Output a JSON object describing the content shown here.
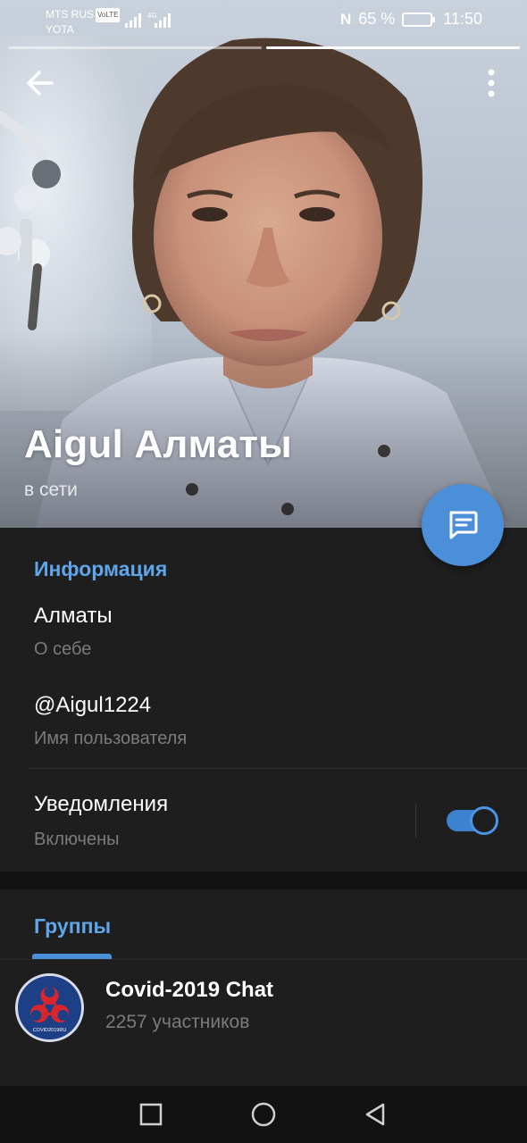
{
  "status_bar": {
    "carrier_line1": "MTS RUS",
    "volte": "VoLTE",
    "carrier_line2": "YOTA",
    "network": "4G",
    "battery": "65 %",
    "time": "11:50"
  },
  "profile": {
    "name": "Aigul Алматы",
    "status": "в сети"
  },
  "info": {
    "title": "Информация",
    "bio_value": "Алматы",
    "bio_label": "О себе",
    "username_value": "@Aigul1224",
    "username_label": "Имя пользователя",
    "notifications_value": "Уведомления",
    "notifications_label": "Включены",
    "notifications_on": true
  },
  "groups": {
    "title": "Группы",
    "items": [
      {
        "name": "Covid-2019 Chat",
        "members": "2257 участников",
        "avatar_text": "COVID2019RU"
      }
    ]
  },
  "colors": {
    "accent": "#4a8fd8",
    "section_title": "#5ea5ea",
    "background": "#1e1e1e"
  },
  "icons": [
    "back-arrow-icon",
    "more-vert-icon",
    "message-icon",
    "biohazard-icon",
    "nav-square-icon",
    "nav-circle-icon",
    "nav-back-triangle-icon"
  ]
}
